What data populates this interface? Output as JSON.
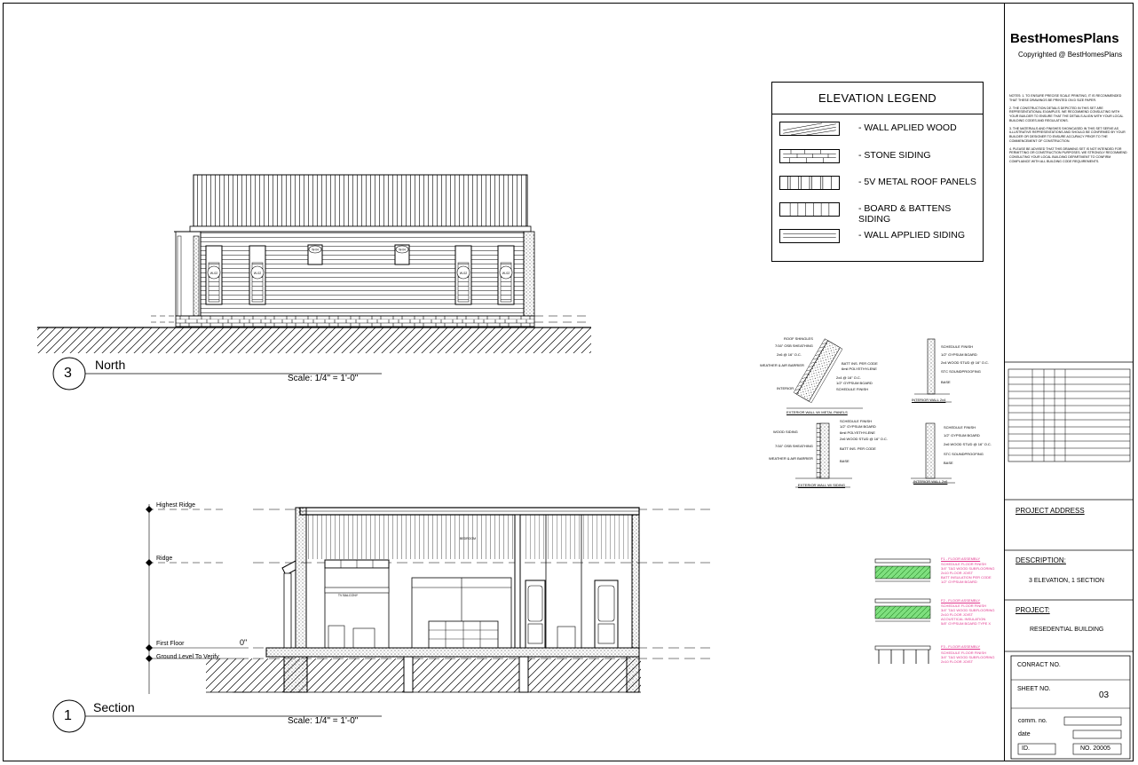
{
  "views": {
    "north": {
      "number": "3",
      "title": "North",
      "scale": "Scale: 1/4\"  =   1'-0\""
    },
    "section": {
      "number": "1",
      "title": "Section",
      "scale": "Scale: 1/4\"  =   1'-0\""
    }
  },
  "window_tags": [
    "W-02",
    "W-02",
    "W-04",
    "W-04",
    "W-02",
    "W-02"
  ],
  "levels": [
    {
      "label": "Highest Ridge",
      "value": ""
    },
    {
      "label": "Ridge",
      "value": ""
    },
    {
      "label": "First Floor",
      "value": "0\""
    },
    {
      "label": "Ground Level To Verify",
      "value": ""
    }
  ],
  "legend": {
    "title": "ELEVATION LEGEND",
    "items": [
      {
        "label": "- WALL APLIED WOOD",
        "pattern": "diagonal"
      },
      {
        "label": "- STONE SIDING",
        "pattern": "stone"
      },
      {
        "label": "- 5V METAL ROOF PANELS",
        "pattern": "metal"
      },
      {
        "label": "- BOARD & BATTENS SIDING",
        "pattern": "batten"
      },
      {
        "label": "- WALL APPLIED SIDING",
        "pattern": "siding"
      }
    ]
  },
  "wall_details": [
    {
      "caption": "EXTERIOR WALL W/ METAL PANELS",
      "labels": [
        "ROOF SHINGLES",
        "7/16\" OSB SHEATHING",
        "2x6 @ 16\" O.C.",
        "WEATHER & AIR BARRIER",
        "INTERIOR",
        "BATT INS. PER CODE",
        "6mil POLYETHYLENE",
        "2x4 @ 16\" O.C.",
        "1/2\" GYPSUM BOARD",
        "SCHEDULE FINISH"
      ]
    },
    {
      "caption": "INTERIOR WALL 2x4",
      "labels": [
        "SCHEDULE FINISH",
        "1/2\" GYPSUM BOARD",
        "2x4 WOOD STUD @ 16\" O.C.",
        "STC SOUNDPROOFING",
        "BASE"
      ]
    },
    {
      "caption": "EXTERIOR WALL W/ SIDING",
      "labels": [
        "WOOD SIDING",
        "7/16\" OSB SHEATHING",
        "WEATHER & AIR BARRIER",
        "SCHEDULE FINISH",
        "1/2\" GYPSUM BOARD",
        "6mil POLYETHYLENE",
        "2x6 WOOD STUD @ 16\" O.C.",
        "BATT INS. PER CODE",
        "BASE"
      ]
    },
    {
      "caption": "INTERIOR WALL 2x6",
      "labels": [
        "SCHEDULE FINISH",
        "1/2\" GYPSUM BOARD",
        "2x6 WOOD STUD @ 16\" O.C.",
        "STC SOUNDPROOFING",
        "BASE"
      ]
    }
  ],
  "floor_details": [
    {
      "title": "F1 - FLOOR ASSEMBLY",
      "notes": [
        "SCHEDULE FLOOR FINISH",
        "3/4\" T&G WOOD SUBFLOORING",
        "2x10 FLOOR JOIST",
        "BATT INSULATION PER CODE",
        "1/2\" GYPSUM BOARD"
      ]
    },
    {
      "title": "F2 - FLOOR ASSEMBLY",
      "notes": [
        "SCHEDULE FLOOR FINISH",
        "3/4\" T&G WOOD SUBFLOORING",
        "2x10 FLOOR JOIST",
        "ACOUSTICAL INSULATION",
        "5/8\" GYPSUM BOARD TYPE X"
      ]
    },
    {
      "title": "F3 - FLOOR ASSEMBLY",
      "notes": [
        "SCHEDULE FLOOR FINISH",
        "3/4\" T&G WOOD SUBFLOORING",
        "2x10 FLOOR JOIST"
      ]
    }
  ],
  "section_labels": {
    "room_a": "TV BALCONY",
    "room_b": "BEDROOM"
  },
  "title_block": {
    "brand": "BestHomesPlans",
    "copyright": "Copyrighted @ BestHomesPlans",
    "notes": [
      "NOTES: 1. TO ENSURE PRECISE SCALE PRINTING, IT IS RECOMMENDED THAT THESE DRAWINGS BE PRINTED ON D SIZE PAPER.",
      "2. THE CONSTRUCTION DETAILS DEPICTED IN THIS SET ARE REPRESENTATIONAL EXAMPLES. WE RECOMMEND CONSULTING WITH YOUR BUILDER TO ENSURE THAT THE DETAILS ALIGN WITH YOUR LOCAL BUILDING CODES AND REGULATIONS.",
      "3. THE MATERIALS AND FINISHES SHOWCASED IN THIS SET SERVE AS ILLUSTRATIVE REPRESENTATIONS AND SHOULD BE CONFIRMED BY YOUR BUILDER OR DESIGNER TO ENSURE ACCURACY PRIOR TO THE COMMENCEMENT OF CONSTRUCTION.",
      "4. PLEASE BE ADVISED THAT THIS DRAWING SET IS NOT INTENDED FOR PERMITTING OR CONSTRUCTION PURPOSES. WE STRONGLY RECOMMEND CONSULTING YOUR LOCAL BUILDING DEPARTMENT TO CONFIRM COMPLIANCE WITH ALL BUILDING CODE REQUIREMENTS."
    ],
    "project_address_label": "PROJECT ADDRESS",
    "description_label": "DESCRIPTION:",
    "description_value": "3 ELEVATION, 1 SECTION",
    "project_label": "PROJECT:",
    "project_value": "RESEDENTIAL BUILDING",
    "contract_label": "CONRACT NO.",
    "sheet_label": "SHEET NO.",
    "sheet_value": "03",
    "comm_label": "comm. no.",
    "date_label": "date",
    "id_label": "ID.",
    "id_value": "NO. 20005"
  }
}
